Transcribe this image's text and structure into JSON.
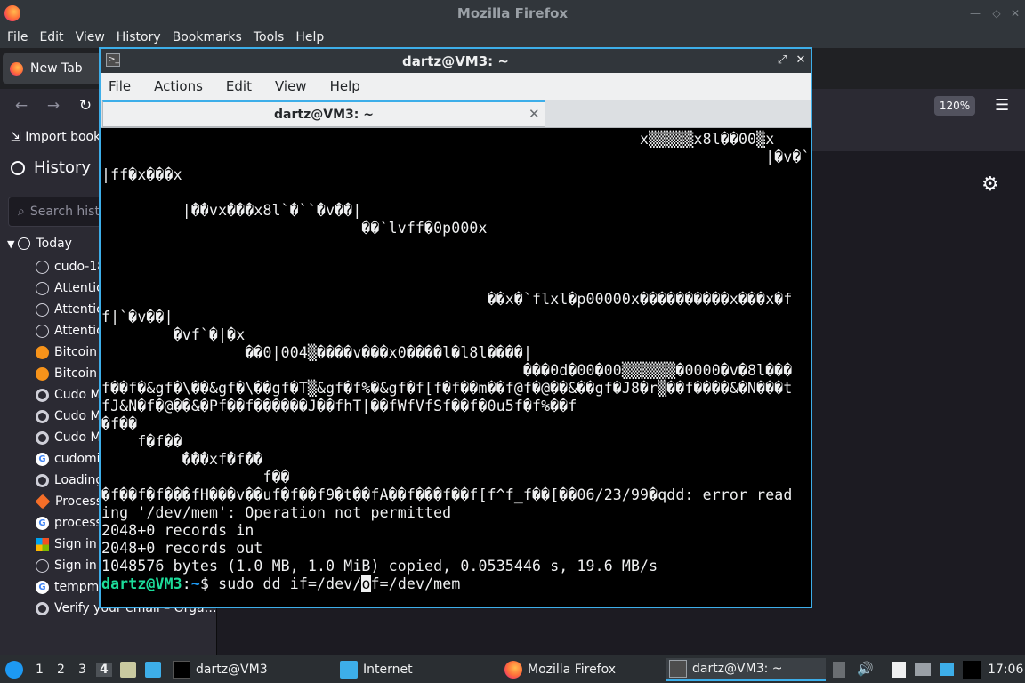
{
  "firefox": {
    "window_title": "Mozilla Firefox",
    "menu": [
      "File",
      "Edit",
      "View",
      "History",
      "Bookmarks",
      "Tools",
      "Help"
    ],
    "tab_label": "New Tab",
    "zoom": "120%",
    "bookmark_import": "Import book",
    "sidebar": {
      "title": "History",
      "search_placeholder": "Search hist",
      "group_label": "Today",
      "items": [
        {
          "label": "cudo-18",
          "icon": "globe-icon"
        },
        {
          "label": "Attentic",
          "icon": "globe-icon"
        },
        {
          "label": "Attentic",
          "icon": "globe-icon"
        },
        {
          "label": "Attentic",
          "icon": "globe-icon"
        },
        {
          "label": "Bitcoin",
          "icon": "bitcoin-icon"
        },
        {
          "label": "Bitcoin",
          "icon": "bitcoin-icon"
        },
        {
          "label": "Cudo M",
          "icon": "cudo-icon"
        },
        {
          "label": "Cudo M",
          "icon": "cudo-icon"
        },
        {
          "label": "Cudo M",
          "icon": "cudo-icon"
        },
        {
          "label": "cudomi",
          "icon": "google-icon"
        },
        {
          "label": "Loading",
          "icon": "cudo-icon"
        },
        {
          "label": "Process",
          "icon": "process-icon"
        },
        {
          "label": "process",
          "icon": "google-icon"
        },
        {
          "label": "Sign in",
          "icon": "microsoft-icon"
        },
        {
          "label": "Sign in",
          "icon": "globe-icon"
        },
        {
          "label": "tempma",
          "icon": "google-icon"
        },
        {
          "label": "Verify your email – Orga…",
          "icon": "cudo-icon"
        }
      ]
    }
  },
  "terminal": {
    "window_title": "dartz@VM3: ~",
    "menu": [
      "File",
      "Actions",
      "Edit",
      "View",
      "Help"
    ],
    "tab_label": "dartz@VM3: ~",
    "lines": [
      "                                                            x▒▒▒▒▒x8l��00▒x",
      "                                                                          |�v�``",
      "|ff�x���x",
      "",
      "         |��vx���x8l`�``�v��|",
      "                             ��`lvff�0p000x",
      "",
      "",
      "",
      "                                           ��x�`flxl�p00000x����������x���x�f",
      "f|`�v��|",
      "        �vf`�|�x",
      "                ��0|004▒����v���x0����l�l8l����|",
      "                                               ���0d�00�00▒▒▒▒▒▒�0000�v�8l���",
      "f��f�&gf�\\��&gf�\\��gf�T▒&gf�f%�&gf�f[f�f��m��f@f�@��&��gf�J8�r▒��f����&�N���t",
      "fJ&N�f�@��&�Pf��f������J��fhT|��fWfVfSf��f�0u5f�f%��f",
      "�f��",
      "    f�f��",
      "         ���xf�f��",
      "                  f��",
      "�f��f�f���fH���v��uf�f��f9�t��fA��f���f��f[f^f_f��[��06/23/99�qdd: error read",
      "ing '/dev/mem': Operation not permitted",
      "2048+0 records in",
      "2048+0 records out",
      "1048576 bytes (1.0 MB, 1.0 MiB) copied, 0.0535446 s, 19.6 MB/s"
    ],
    "prompt_user": "dartz@VM3",
    "prompt_sep": ":",
    "prompt_path": "~",
    "prompt_symbol": "$ ",
    "command_before_cursor": "sudo dd if=/dev/",
    "command_cursor_char": "o",
    "command_after_cursor": "f=/dev/mem"
  },
  "taskbar": {
    "desktops": [
      "1",
      "2",
      "3",
      "4"
    ],
    "active_desktop": "4",
    "tasks": [
      "dartz@VM3",
      "Internet",
      "Mozilla Firefox",
      "dartz@VM3: ~"
    ],
    "clock": "17:06"
  }
}
